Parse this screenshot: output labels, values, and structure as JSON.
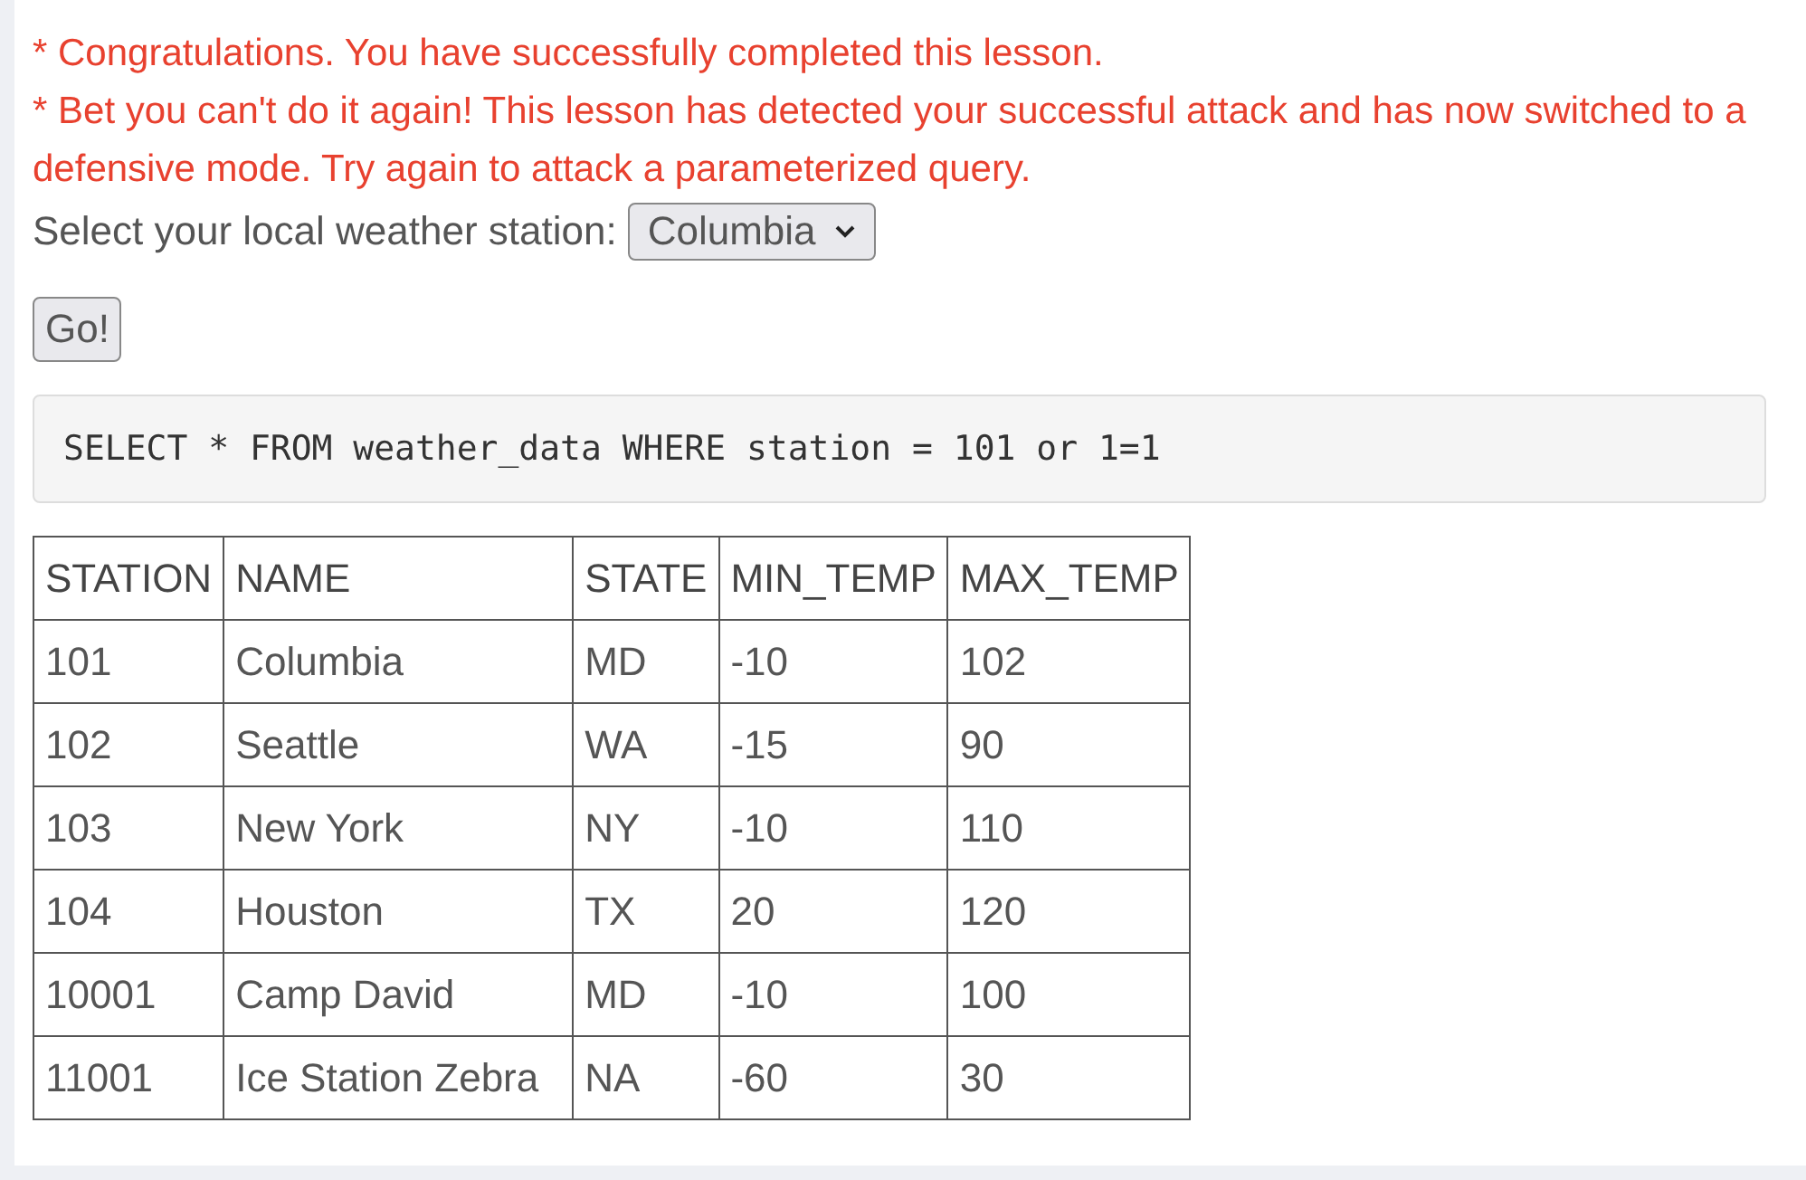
{
  "messages": [
    "* Congratulations. You have successfully completed this lesson.",
    "* Bet you can't do it again! This lesson has detected your successful attack and has now switched to a defensive mode. Try again to attack a parameterized query."
  ],
  "station_select": {
    "label": "Select your local weather station:",
    "value": "Columbia"
  },
  "go_button": "Go!",
  "query": "SELECT * FROM weather_data WHERE station = 101 or 1=1",
  "table": {
    "columns": [
      "STATION",
      "NAME",
      "STATE",
      "MIN_TEMP",
      "MAX_TEMP"
    ],
    "rows": [
      [
        "101",
        "Columbia",
        "MD",
        "-10",
        "102"
      ],
      [
        "102",
        "Seattle",
        "WA",
        "-15",
        "90"
      ],
      [
        "103",
        "New York",
        "NY",
        "-10",
        "110"
      ],
      [
        "104",
        "Houston",
        "TX",
        "20",
        "120"
      ],
      [
        "10001",
        "Camp David",
        "MD",
        "-10",
        "100"
      ],
      [
        "11001",
        "Ice Station Zebra",
        "NA",
        "-60",
        "30"
      ]
    ]
  }
}
